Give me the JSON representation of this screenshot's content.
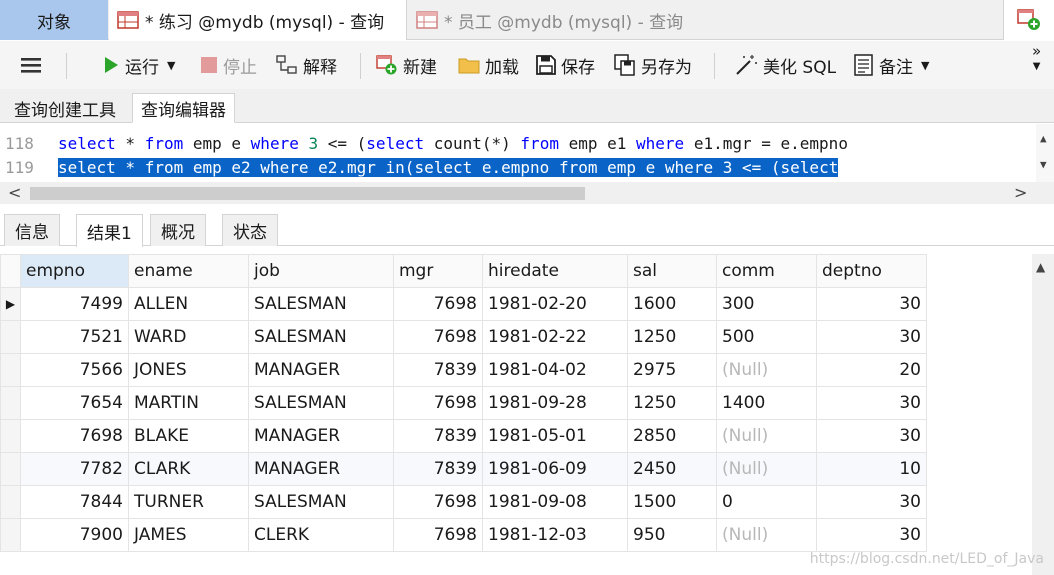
{
  "tabs": {
    "objects": "对象",
    "active_tab": "* 练习 @mydb (mysql) - 查询",
    "inactive_tab": "* 员工 @mydb (mysql) - 查询"
  },
  "toolbar": {
    "run": "运行",
    "stop": "停止",
    "explain": "解释",
    "new": "新建",
    "load": "加载",
    "save": "保存",
    "save_as": "另存为",
    "beautify": "美化 SQL",
    "notes": "备注",
    "more": "»"
  },
  "subtabs": {
    "builder": "查询创建工具",
    "editor": "查询编辑器"
  },
  "editor": {
    "lines": [
      {
        "number": "118",
        "code": "select * from emp e where 3 <= (select count(*) from emp e1 where e1.mgr = e.empno"
      },
      {
        "number": "119",
        "code": "select * from emp e2 where e2.mgr in(select e.empno from emp e where 3 <= (select"
      }
    ]
  },
  "result_tabs": [
    "信息",
    "结果1",
    "概况",
    "状态"
  ],
  "grid": {
    "columns": [
      "empno",
      "ename",
      "job",
      "mgr",
      "hiredate",
      "sal",
      "comm",
      "deptno"
    ],
    "rows": [
      [
        "7499",
        "ALLEN",
        "SALESMAN",
        "7698",
        "1981-02-20",
        "1600",
        "300",
        "30"
      ],
      [
        "7521",
        "WARD",
        "SALESMAN",
        "7698",
        "1981-02-22",
        "1250",
        "500",
        "30"
      ],
      [
        "7566",
        "JONES",
        "MANAGER",
        "7839",
        "1981-04-02",
        "2975",
        "(Null)",
        "20"
      ],
      [
        "7654",
        "MARTIN",
        "SALESMAN",
        "7698",
        "1981-09-28",
        "1250",
        "1400",
        "30"
      ],
      [
        "7698",
        "BLAKE",
        "MANAGER",
        "7839",
        "1981-05-01",
        "2850",
        "(Null)",
        "30"
      ],
      [
        "7782",
        "CLARK",
        "MANAGER",
        "7839",
        "1981-06-09",
        "2450",
        "(Null)",
        "10"
      ],
      [
        "7844",
        "TURNER",
        "SALESMAN",
        "7698",
        "1981-09-08",
        "1500",
        "0",
        "30"
      ],
      [
        "7900",
        "JAMES",
        "CLERK",
        "7698",
        "1981-12-03",
        "950",
        "(Null)",
        "30"
      ]
    ]
  },
  "watermark": "https://blog.csdn.net/LED_of_Java",
  "colors": {
    "accent_tab": "#a9c6ec",
    "selection": "#0a64c8",
    "run_green": "#2aa52a",
    "keyword_blue": "#0000ff"
  }
}
